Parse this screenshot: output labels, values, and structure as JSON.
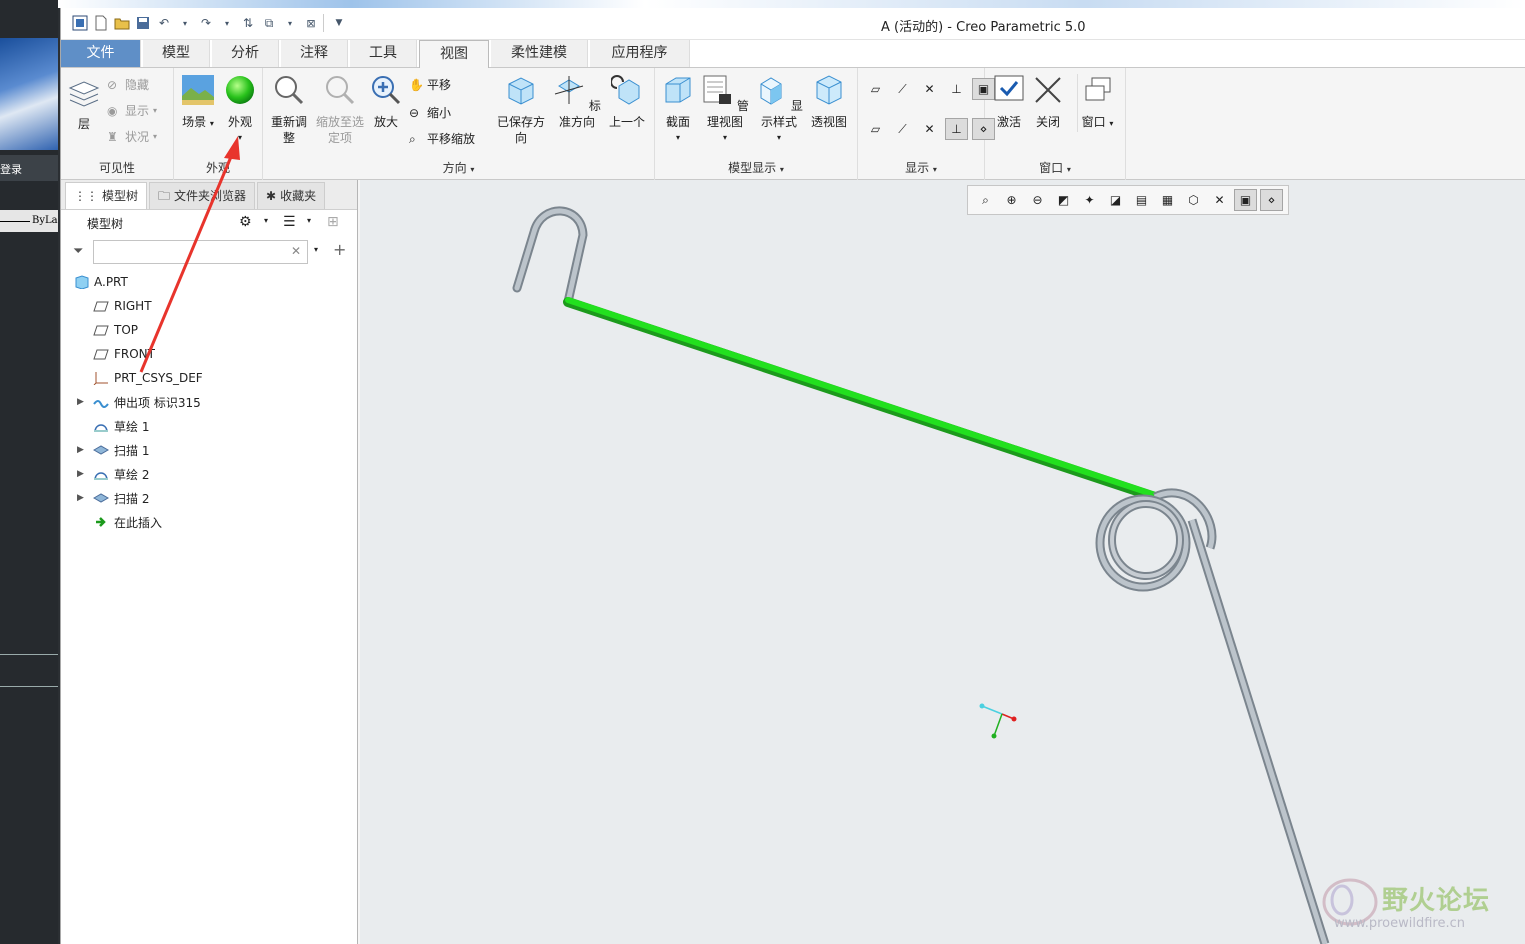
{
  "desktop": {
    "left_strip_text": "登录",
    "bylayer_text": "ByLa"
  },
  "window": {
    "title": "A (活动的) - Creo Parametric 5.0"
  },
  "tabs": [
    {
      "label": "文件"
    },
    {
      "label": "模型"
    },
    {
      "label": "分析"
    },
    {
      "label": "注释"
    },
    {
      "label": "工具"
    },
    {
      "label": "视图"
    },
    {
      "label": "柔性建模"
    },
    {
      "label": "应用程序"
    }
  ],
  "active_tab": "视图",
  "ribbon": {
    "visibility": {
      "layer": "层",
      "hide": "隐藏",
      "show": "显示",
      "status": "状况",
      "label": "可见性"
    },
    "appearance": {
      "scene": "场景",
      "appearance": "外观",
      "label": "外观"
    },
    "orientation": {
      "refit": "重新调整",
      "zoom_selected": "缩放至选定项",
      "zoom_in": "放大",
      "pan": "平移",
      "zoom_out": "缩小",
      "pan_zoom": "平移缩放",
      "saved": "已保存方向",
      "standard": "标准方向",
      "previous": "上一个",
      "label": "方向"
    },
    "model_display": {
      "section": "截面",
      "manage_views": "管理视图",
      "display_style": "显示样式",
      "perspective": "透视图",
      "label": "模型显示"
    },
    "show": {
      "label": "显示"
    },
    "window": {
      "activate": "激活",
      "close": "关闭",
      "windows": "窗口",
      "label": "窗口"
    }
  },
  "left_panel": {
    "tabs": [
      {
        "label": "模型树"
      },
      {
        "label": "文件夹浏览器"
      },
      {
        "label": "收藏夹"
      }
    ],
    "tree_title": "模型树",
    "search_placeholder": "",
    "items": [
      {
        "label": "A.PRT",
        "icon": "part-icon"
      },
      {
        "label": "RIGHT",
        "icon": "datum-plane-icon"
      },
      {
        "label": "TOP",
        "icon": "datum-plane-icon"
      },
      {
        "label": "FRONT",
        "icon": "datum-plane-icon"
      },
      {
        "label": "PRT_CSYS_DEF",
        "icon": "csys-icon"
      },
      {
        "label": "伸出项 标识315",
        "icon": "protrusion-icon",
        "expandable": true
      },
      {
        "label": "草绘 1",
        "icon": "sketch-icon"
      },
      {
        "label": "扫描 1",
        "icon": "sweep-icon",
        "expandable": true
      },
      {
        "label": "草绘 2",
        "icon": "sketch-icon",
        "expandable": true
      },
      {
        "label": "扫描 2",
        "icon": "sweep-icon",
        "expandable": true
      },
      {
        "label": "在此插入",
        "icon": "insert-arrow-icon"
      }
    ]
  },
  "graphics": {
    "background": "#e9ecee",
    "highlight_color": "#22e01e",
    "wire_color": "#aeb6bd"
  },
  "watermark": {
    "title": "野火论坛",
    "url": "www.proewildfire.cn"
  },
  "annotation": {
    "arrow_color": "#e8342c"
  }
}
